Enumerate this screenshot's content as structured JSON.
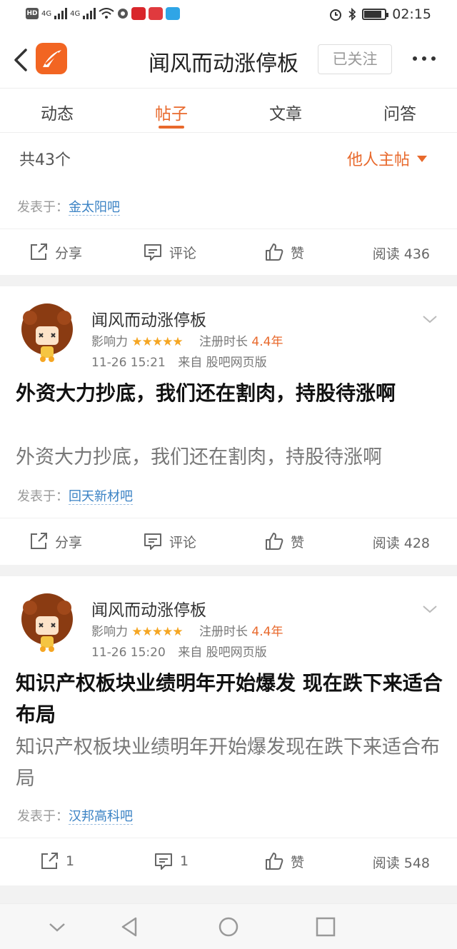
{
  "status_bar": {
    "hd_label": "HD",
    "network_1": "4G",
    "network_2": "4G",
    "time": "02:15",
    "battery_level": 0.85
  },
  "header": {
    "title": "闻风而动涨停板",
    "follow_label": "已关注"
  },
  "tabs": [
    {
      "label": "动态"
    },
    {
      "label": "帖子"
    },
    {
      "label": "文章"
    },
    {
      "label": "问答"
    }
  ],
  "summary": {
    "count": "共43个",
    "filter": "他人主帖"
  },
  "top_partial": {
    "posted_in_label": "发表于：",
    "forum": "金太阳吧",
    "share": "分享",
    "comment": "评论",
    "like": "赞",
    "read": "阅读 436"
  },
  "posts": [
    {
      "author": "闻风而动涨停板",
      "influence_label": "影响力",
      "stars": "★★★★★",
      "reg_label": "注册时长",
      "reg_years": "4.4年",
      "time": "11-26 15:21",
      "source": "来自 股吧网页版",
      "title": "外资大力抄底，我们还在割肉，持股待涨啊",
      "body": "外资大力抄底，我们还在割肉，持股待涨啊",
      "posted_in_label": "发表于：",
      "forum": "回天新材吧",
      "share": "分享",
      "comment": "评论",
      "like": "赞",
      "read": "阅读 428"
    },
    {
      "author": "闻风而动涨停板",
      "influence_label": "影响力",
      "stars": "★★★★★",
      "reg_label": "注册时长",
      "reg_years": "4.4年",
      "time": "11-26 15:20",
      "source": "来自 股吧网页版",
      "title": "知识产权板块业绩明年开始爆发 现在跌下来适合布局",
      "body": "知识产权板块业绩明年开始爆发现在跌下来适合布局",
      "posted_in_label": "发表于：",
      "forum": "汉邦高科吧",
      "share": "1",
      "comment": "1",
      "like": "赞",
      "read": "阅读 548"
    }
  ],
  "colors": {
    "accent": "#e8692c",
    "link": "#3a82c4",
    "star": "#f5a623"
  },
  "icons": [
    "back-arrow-icon",
    "app-logo-icon",
    "more-icon",
    "share-icon",
    "comment-icon",
    "like-icon",
    "chevron-down-icon",
    "avatar-icon",
    "nav-down-icon",
    "nav-back-icon",
    "nav-home-icon",
    "nav-recent-icon"
  ]
}
